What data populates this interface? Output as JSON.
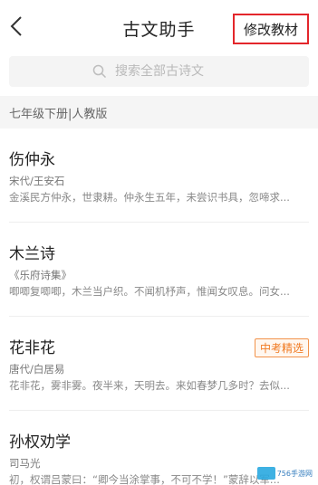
{
  "header": {
    "title": "古文助手",
    "edit_label": "修改教材"
  },
  "search": {
    "placeholder": "搜索全部古诗文"
  },
  "section": {
    "label": "七年级下册|人教版"
  },
  "items": [
    {
      "title": "伤仲永",
      "author": "宋代/王安石",
      "excerpt": "金溪民方仲永，世隶耕。仲永生五年，未尝识书具，忽啼求...",
      "badge": ""
    },
    {
      "title": "木兰诗",
      "author": "《乐府诗集》",
      "excerpt": "唧唧复唧唧，木兰当户织。不闻机杼声，惟闻女叹息。问女...",
      "badge": ""
    },
    {
      "title": "花非花",
      "author": "唐代/白居易",
      "excerpt": "花非花，雾非雾。夜半来，天明去。来如春梦几多时？去似...",
      "badge": "中考精选"
    },
    {
      "title": "孙权劝学",
      "author": "司马光",
      "excerpt": "初，权谓吕蒙曰：“卿今当涂掌事，不可不学！”蒙辞以军...",
      "badge": ""
    }
  ],
  "watermark": {
    "text": "756手游网"
  },
  "colors": {
    "accent_red": "#e3262b",
    "badge_orange": "#f07a22"
  }
}
